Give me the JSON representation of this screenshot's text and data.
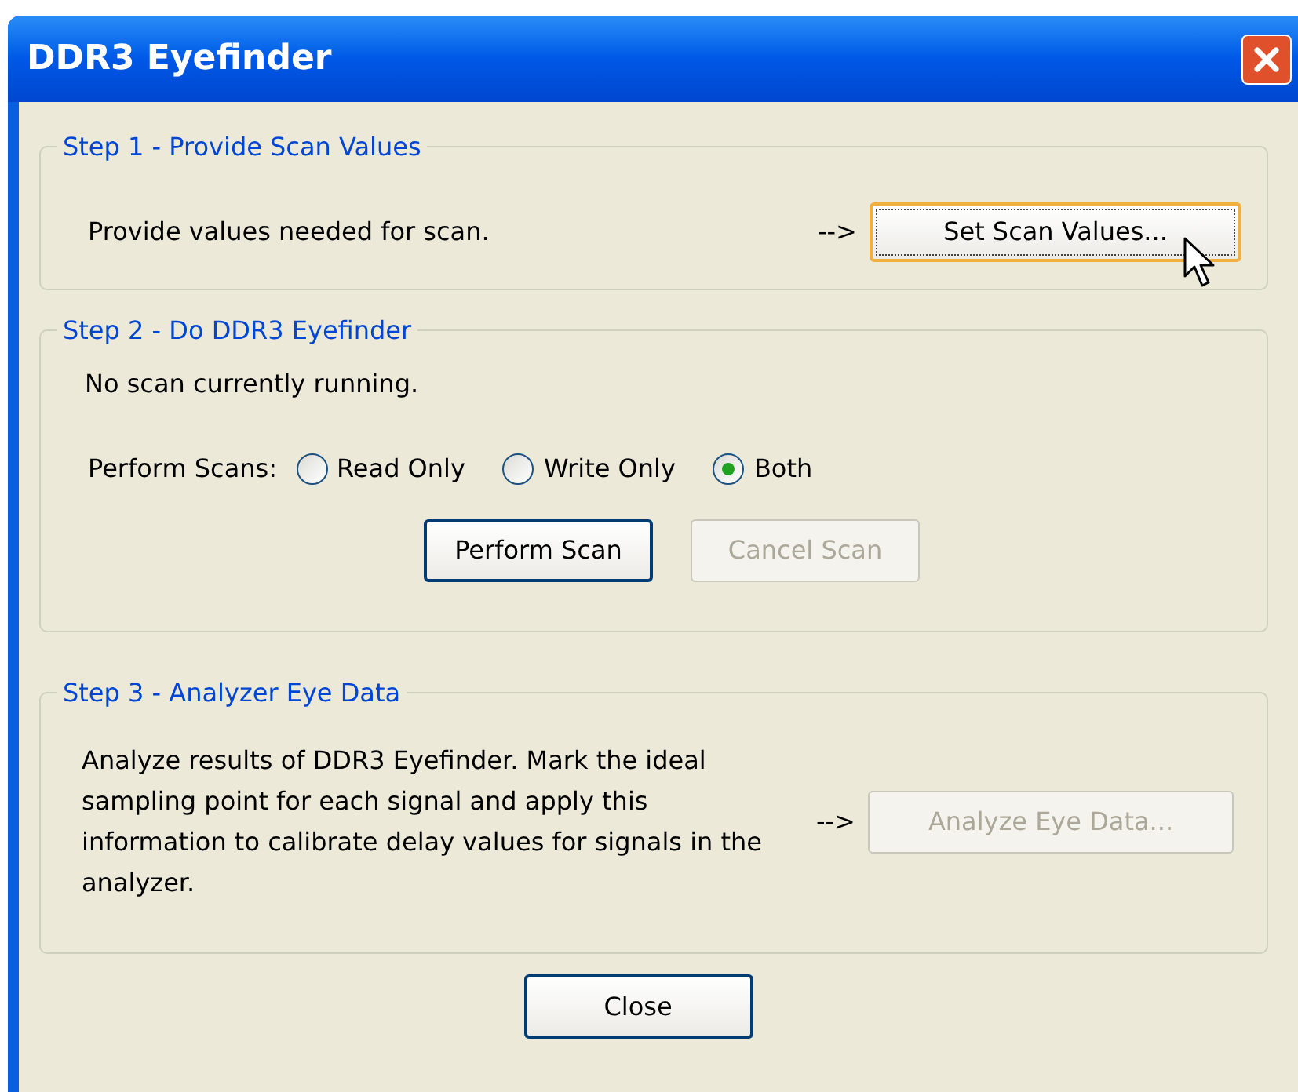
{
  "window": {
    "title": "DDR3 Eyefinder"
  },
  "step1": {
    "legend": "Step 1 - Provide Scan Values",
    "text": "Provide values needed for scan.",
    "arrow": "-->",
    "button": {
      "label": "Set Scan Values...",
      "focused": true,
      "disabled": false
    }
  },
  "step2": {
    "legend": "Step 2 - Do DDR3 Eyefinder",
    "status": "No scan currently running.",
    "scans_label": "Perform Scans:",
    "options": [
      {
        "label": "Read Only",
        "selected": false
      },
      {
        "label": "Write Only",
        "selected": false
      },
      {
        "label": "Both",
        "selected": true
      }
    ],
    "buttons": [
      {
        "label": "Perform Scan",
        "default": true,
        "disabled": false
      },
      {
        "label": "Cancel Scan",
        "disabled": true
      }
    ]
  },
  "step3": {
    "legend": "Step 3 - Analyzer Eye Data",
    "text": "Analyze results of DDR3 Eyefinder. Mark the ideal sampling point for each signal and apply this information to calibrate delay values for signals in the analyzer.",
    "arrow": "-->",
    "button": {
      "label": "Analyze Eye Data...",
      "disabled": true
    }
  },
  "close_button": {
    "label": "Close",
    "disabled": false
  }
}
